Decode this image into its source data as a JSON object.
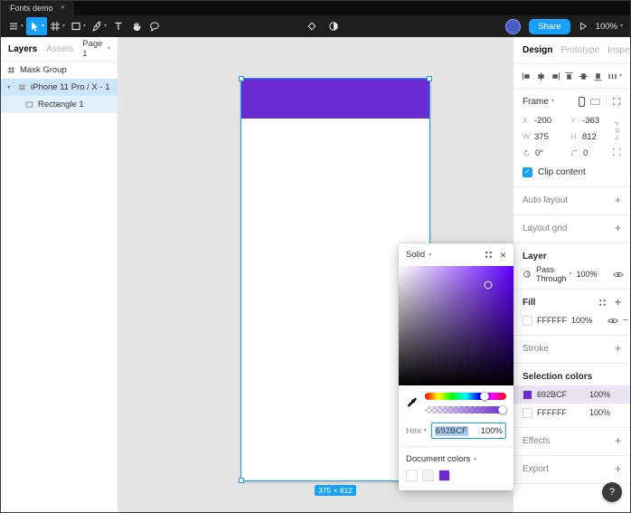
{
  "icons": {
    "chevron": "▾",
    "close": "×",
    "plus": "+",
    "minus": "−",
    "check": "✓"
  },
  "colors": {
    "accent": "#18A0FB",
    "selection_purple": "#692BCF"
  },
  "topbar": {
    "tab_title": "Fonts demo",
    "share_label": "Share",
    "zoom_value": "100%"
  },
  "left_sidebar": {
    "tab_layers": "Layers",
    "tab_assets": "Assets",
    "page_selector": "Page 1",
    "layers": [
      {
        "name": "Mask Group",
        "type": "mask-group"
      },
      {
        "name": "iPhone 11 Pro / X - 1",
        "type": "frame",
        "selected": true
      },
      {
        "name": "Rectangle 1",
        "type": "rectangle"
      }
    ]
  },
  "canvas": {
    "size_badge": "375 × 812",
    "frame_fill": "#FFFFFF",
    "rect_fill": "#692BCF"
  },
  "color_picker": {
    "mode_label": "Solid",
    "hex_label": "Hex",
    "hex_value": "692BCF",
    "opacity_value": "100%",
    "document_colors_label": "Document colors",
    "swatches": [
      "#FFFFFF",
      "#F2F2F2",
      "#692BCF"
    ]
  },
  "right_sidebar": {
    "tab_design": "Design",
    "tab_prototype": "Prototype",
    "tab_inspect": "Inspect",
    "frame_section": {
      "title": "Frame",
      "x_label": "X",
      "x_value": "-200",
      "y_label": "Y",
      "y_value": "-363",
      "w_label": "W",
      "w_value": "375",
      "h_label": "H",
      "h_value": "812",
      "rotation_value": "0°",
      "radius_value": "0",
      "clip_content_label": "Clip content"
    },
    "auto_layout_title": "Auto layout",
    "layout_grid_title": "Layout grid",
    "layer_section": {
      "title": "Layer",
      "blend_mode": "Pass Through",
      "opacity": "100%"
    },
    "fill_section": {
      "title": "Fill",
      "hex": "FFFFFF",
      "opacity": "100%",
      "swatch": "#FFFFFF"
    },
    "stroke_title": "Stroke",
    "selection_colors": {
      "title": "Selection colors",
      "items": [
        {
          "hex": "692BCF",
          "opacity": "100%",
          "swatch": "#692BCF"
        },
        {
          "hex": "FFFFFF",
          "opacity": "100%",
          "swatch": "#FFFFFF"
        }
      ]
    },
    "effects_title": "Effects",
    "export_title": "Export",
    "help_label": "?"
  }
}
